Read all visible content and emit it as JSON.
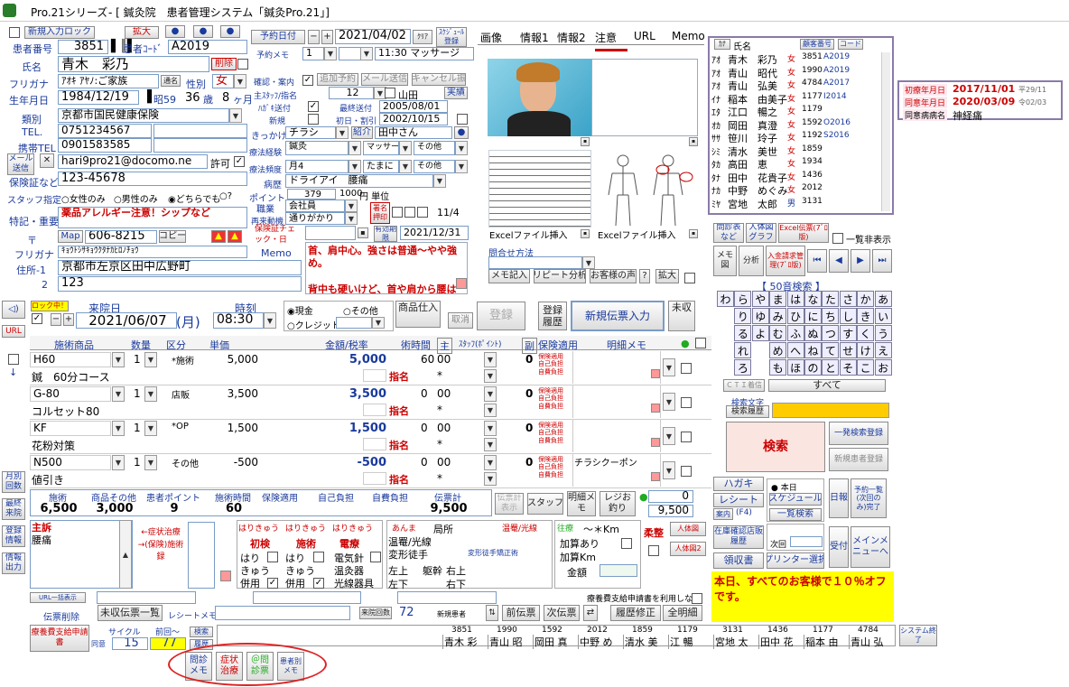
{
  "window": {
    "app": "Pro.21シリーズ",
    "title": "- [ 鍼灸院　患者管理システム「鍼灸Pro.21」]"
  },
  "patient": {
    "new_lock": "新規入力ロック",
    "zoom": "拡大",
    "id_label": "患者番号",
    "id": "3851",
    "code_label": "患者ｺｰﾄﾞ",
    "code": "A2019",
    "name_label": "氏名",
    "name": "青木　彩乃",
    "delete": "削除",
    "furigana_label": "フリガナ",
    "furigana": "ｱｵｷ ｱﾔﾉ:ご家族",
    "nickname": "通名",
    "gender_label": "性別",
    "gender": "女",
    "dob_label": "生年月日",
    "dob": "1984/12/19",
    "era": "昭59",
    "age": "36",
    "age_unit": "歳",
    "months": "8",
    "month_unit": "ヶ月",
    "category_label": "類別",
    "category": "京都市国民健康保険",
    "tel_label": "TEL.",
    "tel": "0751234567",
    "mobile_label": "携帯TEL",
    "mobile": "0901583585",
    "mail_btn": "メール送信",
    "email": "hari9pro21@docomo.ne",
    "permit": "許可",
    "insurance_label": "保険証など",
    "insurance": "123-45678",
    "staff_label": "スタッフ指定",
    "staff_opts": [
      "女性のみ",
      "男性のみ",
      "どちらでも",
      "?"
    ],
    "feature_label": "特記・重要",
    "feature": "薬品アレルギー注意！シップなど",
    "zip_label": "〒",
    "map": "Map",
    "zip": "606-8215",
    "copy": "コピー",
    "addr_kana_label": "フリガナ",
    "addr_kana": "ｷｮｳﾄｼｻｷｮｳｸﾀﾅｶﾋﾛﾉﾁｮｳ",
    "memo_label": "Memo",
    "addr1_label": "住所-1",
    "addr1": "京都市左京区田中広野町",
    "addr2_label": "2",
    "addr2": "123"
  },
  "appointment": {
    "date_btn": "予約日付",
    "date": "2021/04/02",
    "clear": "ｸﾘｱ",
    "schedule": "ｽｹｼﾞｭｰﾙ登録",
    "memo_label": "予約メモ",
    "count": "1",
    "time": "11:30 マッサージ",
    "confirm_label": "確認・案内",
    "add": "追加予約",
    "mail": "メール送信",
    "cancel": "キャンセル振",
    "staff_label": "主ｽﾀｯﾌ/指名",
    "staff_num": "12",
    "staff_name": "山田",
    "actual": "実績",
    "postcard_label": "ﾊｶﾞｷ送付",
    "last_sent_label": "最終送付",
    "last_sent": "2005/08/01",
    "new_label": "新規",
    "first_label": "初日・割引",
    "first": "2002/10/15",
    "trigger_label": "きっかけ",
    "trigger": "チラシ",
    "intro": "紹介",
    "intro_name": "田中さん",
    "therapy_label": "療法経験",
    "therapy1": "鍼灸",
    "therapy2": "マッサージ",
    "therapy3": "その他",
    "freq_label": "療法頻度",
    "freq1": "月4",
    "freq2": "たまに",
    "freq3": "その他",
    "disease_label": "病歴",
    "disease": "ドライアイ　腰痛",
    "point_label": "ポイント",
    "point": "379",
    "point_yen": "1000",
    "point_unit": "円 単位",
    "job_label": "職業",
    "job": "会社員",
    "visit_label": "再来動機",
    "visit": "通りがかり",
    "consent_label": "保険証チェック・日",
    "consent": "11/4",
    "expiry": "2021/12/31",
    "expire_label": "有効期限",
    "notes": "首、肩中心。強さは普通～やや強め。\n\n背中も硬いけど、首や肩から腰は強さ普通で。"
  },
  "tabs": [
    "画像",
    "情報1",
    "情報2",
    "注意",
    "URL",
    "Memo"
  ],
  "media": {
    "excel1": "Excelファイル挿入",
    "excel2": "Excelファイル挿入",
    "inquiry": "問合せ方法",
    "memo": "メモ記入",
    "repeat": "リピート分析",
    "voice": "お客様の声",
    "zoom": "拡大"
  },
  "patient_list": {
    "headers": [
      "ｶﾅ",
      "氏名",
      "顧客番号",
      "コード"
    ],
    "rows": [
      {
        "k": "ｱｵ",
        "n": "青木　彩乃",
        "g": "女",
        "id": "3851",
        "c": "A2019"
      },
      {
        "k": "ｱｵ",
        "n": "青山　昭代",
        "g": "女",
        "id": "1990",
        "c": "A2019"
      },
      {
        "k": "ｱｵ",
        "n": "青山　弘美",
        "g": "女",
        "id": "4784",
        "c": "A2017"
      },
      {
        "k": "ｲﾅ",
        "n": "稲本　由美子",
        "g": "女",
        "id": "1177",
        "c": "I2014"
      },
      {
        "k": "ｴﾀ",
        "n": "江口　暢之",
        "g": "女",
        "id": "1179",
        "c": ""
      },
      {
        "k": "ｵｶ",
        "n": "岡田　真澄",
        "g": "女",
        "id": "1592",
        "c": "O2016"
      },
      {
        "k": "ｻｻ",
        "n": "笹川　玲子",
        "g": "女",
        "id": "1192",
        "c": "S2016"
      },
      {
        "k": "ｼﾐ",
        "n": "清水　美世",
        "g": "女",
        "id": "1859",
        "c": ""
      },
      {
        "k": "ﾀｶ",
        "n": "高田　恵",
        "g": "女",
        "id": "1934",
        "c": ""
      },
      {
        "k": "ﾀﾅ",
        "n": "田中　花貴子",
        "g": "女",
        "id": "1436",
        "c": ""
      },
      {
        "k": "ﾅｶ",
        "n": "中野　めぐみ",
        "g": "女",
        "id": "2012",
        "c": ""
      },
      {
        "k": "ﾐﾔ",
        "n": "宮地　太郎",
        "g": "男",
        "id": "3131",
        "c": ""
      }
    ]
  },
  "dates_box": {
    "first_label": "初療年月日",
    "first": "2017/11/01",
    "first_era": "平29/11",
    "consent_label": "同意年月日",
    "consent": "2020/03/09",
    "consent_era": "令02/03",
    "disease_label": "同意病病名",
    "disease": "神経痛"
  },
  "right_buttons": {
    "inquiry": "問診表など",
    "body": "人体図グラフ",
    "excel": "Excel伝票(7ﾞﾛ版)",
    "show_all": "一覧非表示",
    "memo": "メモ図",
    "analysis": "分析",
    "bill": "入金請求管理(7ﾞﾛ版)",
    "kana50": "【 50音検索 】",
    "cti": "ＣＴＩ着信",
    "all": "すべて",
    "search_char": "検索文字",
    "search_hist": "検索履歴",
    "search": "検索",
    "one_search": "一発検索登録",
    "new_reg": "新規患者登録"
  },
  "kana": [
    "わ",
    "ら",
    "や",
    "ま",
    "は",
    "な",
    "た",
    "さ",
    "か",
    "あ",
    "",
    "り",
    "ゆ",
    "み",
    "ひ",
    "に",
    "ち",
    "し",
    "き",
    "い",
    "",
    "る",
    "よ",
    "む",
    "ふ",
    "ぬ",
    "つ",
    "す",
    "く",
    "う",
    "",
    "れ",
    "",
    "め",
    "へ",
    "ね",
    "て",
    "せ",
    "け",
    "え",
    "",
    "ろ",
    "",
    "も",
    "ほ",
    "の",
    "と",
    "そ",
    "こ",
    "お"
  ],
  "visit": {
    "lock": "ロック中！",
    "label": "来院日",
    "date": "2021/06/07",
    "dow": "(月)",
    "time_label": "時刻",
    "time": "08:30",
    "cash": "現金",
    "other": "その他",
    "credit": "クレジット",
    "goods": "商品仕入",
    "cancel": "取消",
    "register": "登録",
    "history": "登録履歴",
    "new_slip": "新規伝票入力",
    "unpaid": "未収"
  },
  "grid": {
    "headers": [
      "施術商品",
      "数量",
      "区分",
      "単価",
      "金額/税率",
      "術時間",
      "主",
      "ｽﾀｯﾌ(ﾎﾟｲﾝﾄ)",
      "副",
      "保険適用",
      "明細メモ"
    ],
    "rows": [
      {
        "code": "H60",
        "name": "鍼　60分コース",
        "qty": "1",
        "kind": "*施術",
        "price": "5,000",
        "amount": "5,000",
        "time": "60",
        "time2": "00",
        "staff": "0",
        "memo": "",
        "ins": "保険適用\n自己負担\n自費負担"
      },
      {
        "code": "G-80",
        "name": "コルセット80",
        "qty": "1",
        "kind": "店販",
        "price": "3,500",
        "amount": "3,500",
        "time": "0",
        "time2": "00",
        "staff": "0",
        "memo": "",
        "ins": "保険適用\n自己負担\n自費負担"
      },
      {
        "code": "KF",
        "name": "花粉対策",
        "qty": "1",
        "kind": "*OP",
        "price": "1,500",
        "amount": "1,500",
        "time": "0",
        "time2": "00",
        "staff": "0",
        "memo": "",
        "ins": "保険適用\n自己負担\n自費負担"
      },
      {
        "code": "N500",
        "name": "値引き",
        "qty": "1",
        "kind": "その他",
        "price": "-500",
        "amount": "-500",
        "time": "0",
        "time2": "00",
        "staff": "0",
        "memo": "チラシクーポン",
        "ins": "保険適用\n自己負担\n自費負担"
      }
    ],
    "nominate": "指名",
    "star": "*"
  },
  "totals": {
    "headers": [
      "施術",
      "商品その他",
      "患者ポイント",
      "施術時間",
      "保険適用",
      "自己負担",
      "自費負担",
      "伝票計"
    ],
    "values": [
      "6,500",
      "3,000",
      "9",
      "60",
      "",
      "",
      "",
      "9,500"
    ],
    "staff": "スタッフ",
    "detail": "明細メモ",
    "register": "レジお釣り",
    "paid": "0",
    "change": "9,500"
  },
  "symptoms": {
    "main_label": "主訴",
    "main": "腰痛",
    "arrow1": "←症状治療→(保険)施術録",
    "acup": [
      "はりきゅう",
      "はりきゅう",
      "はりきゅう"
    ],
    "items": [
      "初検",
      "施術",
      "電療"
    ],
    "sub": [
      "はり",
      "はり",
      "電気針",
      "きゅう",
      "きゅう",
      "温灸器",
      "併用",
      "併用",
      "光線器具"
    ],
    "anma": "あんま",
    "local": "局所",
    "hot": "温罨/光線",
    "hotlight": "温罨/光線",
    "change": "変形徒手",
    "change2": "変形徒手矯正術",
    "ul": "左上",
    "body": "躯幹",
    "ur": "右上",
    "ll": "左下",
    "lr": "右下",
    "inc": "往療",
    "km": "～＊Km",
    "add": "加算あり",
    "addkm": "加算Km",
    "amount": "金額",
    "strong": "柔整",
    "body_chart": "人体図",
    "body_chart2": "人体図2"
  },
  "bottom": {
    "url_list": "URL一括表示",
    "slip_del": "伝票削除",
    "unpaid_list": "未収伝票一覧",
    "receipt": "レシートメモ",
    "visits_label": "来院回数",
    "visits": "72",
    "new_patient": "新規患者",
    "prev": "前伝票",
    "next": "次伝票",
    "hist": "履歴修正",
    "all": "全明細",
    "claim": "療養費支給申請書",
    "claim2": "療養費支給申請書を利用しない",
    "cycle": "サイクル",
    "cycle_v": "15",
    "prev_label": "前回～",
    "prev_v": "77",
    "same": "同意",
    "search": "検索",
    "period": "履歴",
    "end": "システム終了"
  },
  "tabs_bottom": [
    "問診メモ",
    "症状治療",
    "＠問診票",
    "患者別メモ"
  ],
  "history_strip": [
    {
      "id": "3851",
      "n": "青木 彩"
    },
    {
      "id": "1990",
      "n": "青山 昭"
    },
    {
      "id": "1592",
      "n": "岡田 真"
    },
    {
      "id": "2012",
      "n": "中野 め"
    },
    {
      "id": "1859",
      "n": "清水 美"
    },
    {
      "id": "1179",
      "n": "江 暢"
    },
    {
      "id": "3131",
      "n": "宮地 太"
    },
    {
      "id": "1436",
      "n": "田中 花"
    },
    {
      "id": "1177",
      "n": "稲本 由"
    },
    {
      "id": "4784",
      "n": "青山 弘"
    }
  ],
  "side": {
    "url": "URL",
    "items": [
      "月別回数",
      "最終来院",
      "登録情報",
      "情報出力"
    ]
  },
  "right_lower": {
    "postcard": "ハガキ",
    "receipt": "レシート",
    "info": "案内(F4)",
    "today": "本日",
    "schedule": "スケジュール",
    "list": "一覧検索",
    "next": "次回",
    "store": "在庫確認店販履歴",
    "day": "日報",
    "period": "予約一覧(次回のみ)完了",
    "all": "すべて",
    "receipt2": "領収書",
    "printer": "プリンター選択",
    "reception": "受付",
    "menu": "メインメニューへ",
    "notice": "本日、すべてのお客様で１０％オフです。"
  }
}
